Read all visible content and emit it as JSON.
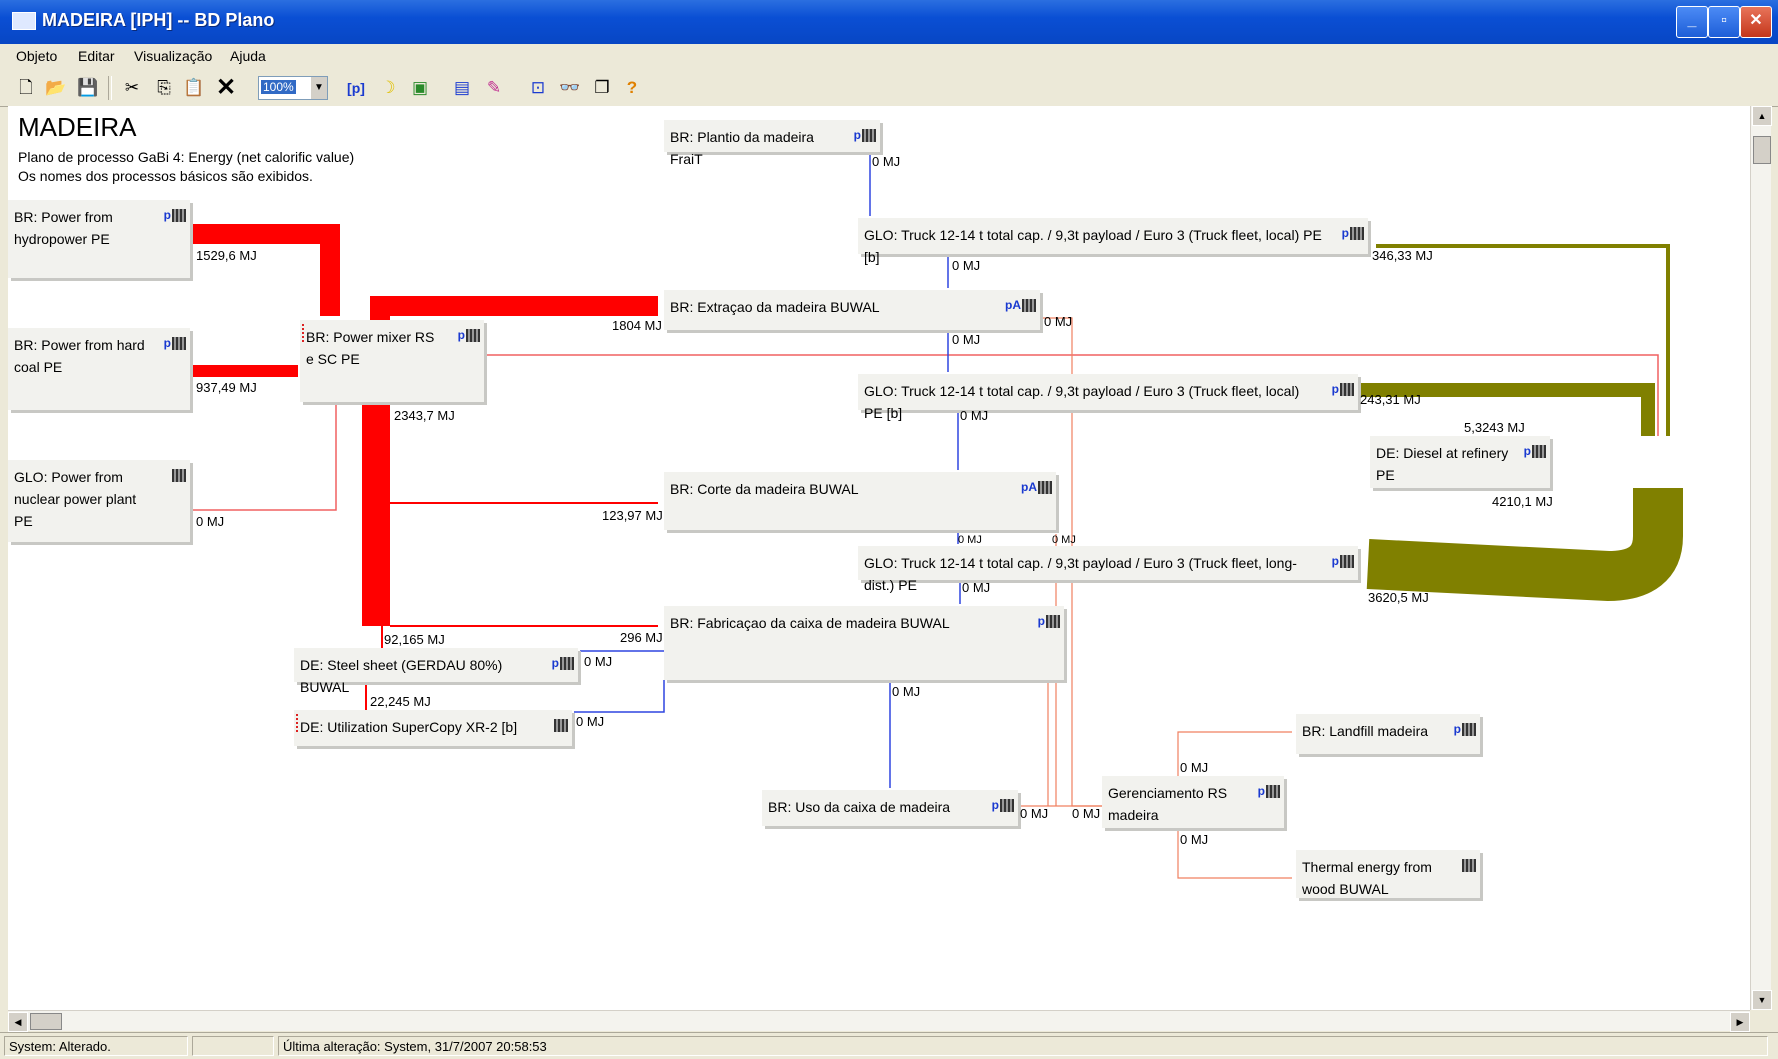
{
  "window": {
    "title": "MADEIRA [IPH] -- BD Plano",
    "minimize": "_",
    "maximize": "▫",
    "close": "✕"
  },
  "menu": [
    "Objeto",
    "Editar",
    "Visualização",
    "Ajuda"
  ],
  "toolbar": {
    "zoom": "100%",
    "icons": [
      "new-icon",
      "open-icon",
      "save-icon",
      "cut-icon",
      "copy-icon",
      "paste-icon",
      "delete-icon",
      "zoom-select",
      "parameter-icon",
      "moon-icon",
      "layers-icon",
      "process-icon",
      "eraser-icon",
      "inspect-icon",
      "binoculars-icon",
      "windows-icon",
      "help-icon"
    ]
  },
  "plan": {
    "name": "MADEIRA",
    "subtitle_line1": "Plano de processo GaBi 4: Energy (net calorific value)",
    "subtitle_line2": "Os nomes dos processos básicos são exibidos."
  },
  "processes": {
    "hydro": "BR: Power from hydropower PE",
    "hardcoal": "BR: Power from hard coal PE",
    "nuclear": "GLO: Power from nuclear power plant PE",
    "mixer": "BR: Power mixer RS e SC PE",
    "plantio": "BR: Plantio da madeira FraiT",
    "truck1": "GLO: Truck 12-14 t total cap. / 9,3t payload / Euro 3 (Truck fleet, local) PE [b]",
    "extracao": "BR: Extraçao da madeira BUWAL",
    "truck2": "GLO: Truck 12-14 t total cap. / 9,3t payload / Euro 3 (Truck fleet, local) PE [b]",
    "diesel": "DE: Diesel at refinery PE",
    "corte": "BR: Corte da madeira BUWAL",
    "truck3": "GLO: Truck 12-14 t total cap. / 9,3t payload / Euro 3 (Truck fleet, long-dist.) PE",
    "fabricacao": "BR: Fabricaçao da caixa de madeira BUWAL",
    "steel": "DE: Steel sheet (GERDAU 80%) BUWAL",
    "utilization": "DE: Utilization SuperCopy XR-2 [b]",
    "uso": "BR: Uso da caixa de madeira",
    "gerenciamento": "Gerenciamento RS madeira",
    "landfill": "BR: Landfill madeira",
    "thermal": "Thermal energy from wood BUWAL"
  },
  "process_icons": {
    "p": "p",
    "pA": "pA"
  },
  "flows": {
    "hydro": "1529,6 MJ",
    "hardcoal": "937,49 MJ",
    "nuclear": "0 MJ",
    "mixer_extracao": "1804 MJ",
    "mixer_down": "2343,7 MJ",
    "plantio": "0 MJ",
    "truck1_out": "0 MJ",
    "diesel_truck1": "346,33 MJ",
    "extracao_side": "0 MJ",
    "extracao_down": "0 MJ",
    "diesel_truck2": "243,31 MJ",
    "mixer_diesel": "5,3243 MJ",
    "diesel_total": "4210,1 MJ",
    "truck2_out": "0 MJ",
    "mixer_corte": "123,97 MJ",
    "corte_a": "0 MJ",
    "corte_b": "0 MJ",
    "truck3_out": "0 MJ",
    "diesel_truck3": "3620,5 MJ",
    "mixer_steel": "92,165 MJ",
    "mixer_fabricacao": "296 MJ",
    "steel_out": "0 MJ",
    "mixer_util": "22,245 MJ",
    "util_out": "0 MJ",
    "fabricacao_out": "0 MJ",
    "uso_out": "0 MJ",
    "ger_in": "0 MJ",
    "ger_landfill": "0 MJ",
    "ger_thermal": "0 MJ"
  },
  "colors": {
    "electricity": "#ff0000",
    "diesel": "#808000",
    "default_flow": "#2f45e0",
    "waste_flow": "#f08060"
  },
  "status": {
    "left": "System: Alterado.",
    "mid": "",
    "right": "Última alteração: System, 31/7/2007 20:58:53"
  }
}
